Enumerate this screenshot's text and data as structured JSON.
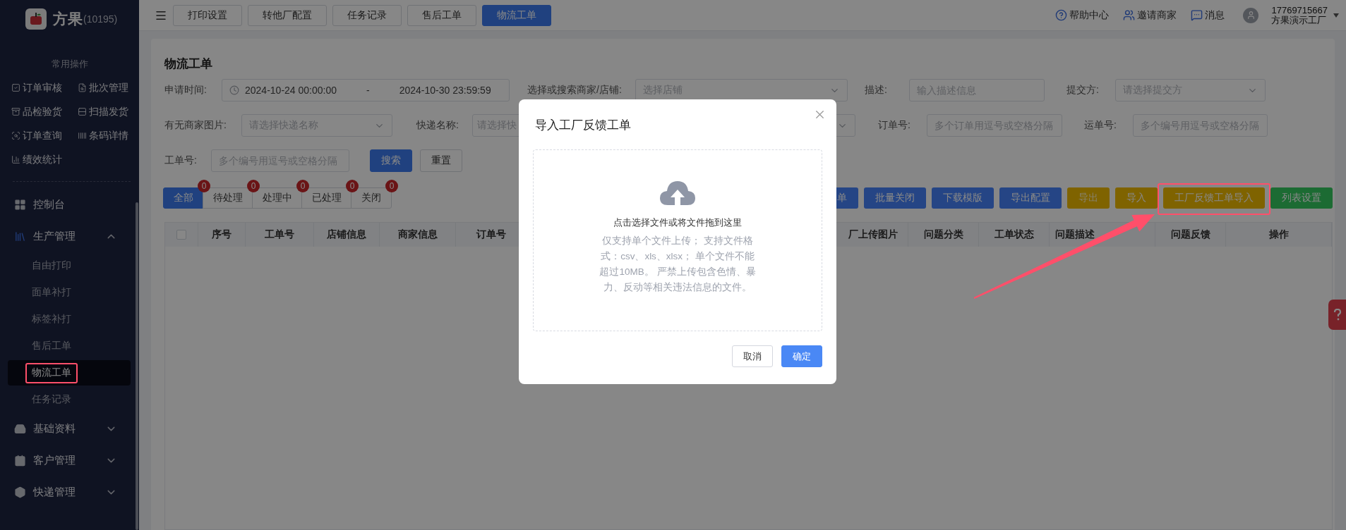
{
  "sidebar": {
    "logo": {
      "name": "方果",
      "code": "(10195)"
    },
    "quick_title": "常用操作",
    "quick_actions": [
      {
        "label": "订单审核"
      },
      {
        "label": "批次管理"
      },
      {
        "label": "品检验货"
      },
      {
        "label": "扫描发货"
      },
      {
        "label": "订单查询"
      },
      {
        "label": "条码详情"
      },
      {
        "label": "绩效统计"
      }
    ],
    "menu": [
      {
        "label": "控制台",
        "kind": "link"
      },
      {
        "label": "生产管理",
        "kind": "group",
        "expanded": true,
        "children": [
          {
            "label": "自由打印",
            "selected": false,
            "highlighted": false
          },
          {
            "label": "面单补打",
            "selected": false,
            "highlighted": false
          },
          {
            "label": "标签补打",
            "selected": false,
            "highlighted": false
          },
          {
            "label": "售后工单",
            "selected": false,
            "highlighted": false
          },
          {
            "label": "物流工单",
            "selected": true,
            "highlighted": true
          },
          {
            "label": "任务记录",
            "selected": false,
            "highlighted": false
          }
        ]
      },
      {
        "label": "基础资料",
        "kind": "group",
        "expanded": false
      },
      {
        "label": "客户管理",
        "kind": "group",
        "expanded": false
      },
      {
        "label": "快递管理",
        "kind": "group",
        "expanded": false
      }
    ]
  },
  "topbar": {
    "tabs": [
      {
        "label": "打印设置",
        "selected": false
      },
      {
        "label": "转他厂配置",
        "selected": false
      },
      {
        "label": "任务记录",
        "selected": false
      },
      {
        "label": "售后工单",
        "selected": false
      },
      {
        "label": "物流工单",
        "selected": true
      }
    ],
    "links": [
      {
        "label": "帮助中心"
      },
      {
        "label": "邀请商家"
      },
      {
        "label": "消息"
      }
    ],
    "user": {
      "phone": "17769715667",
      "name": "方果演示工厂"
    }
  },
  "page": {
    "title": "物流工单",
    "filters": [
      [
        {
          "kind": "date-range",
          "label": "申请时间:",
          "start": "2024-10-24 00:00:00",
          "separator": "-",
          "end": "2024-10-30 23:59:59"
        },
        {
          "kind": "select",
          "label": "选择或搜索商家/店铺:",
          "placeholder": "选择店铺"
        },
        {
          "kind": "input",
          "label": "描述:",
          "placeholder": "输入描述信息"
        },
        {
          "kind": "select",
          "label": "提交方:",
          "placeholder": "请选择提交方"
        }
      ],
      [
        {
          "kind": "select",
          "label": "有无商家图片:",
          "placeholder": "请选择快递名称"
        },
        {
          "kind": "select",
          "label": "快递名称:",
          "placeholder": "请选择快"
        },
        {
          "kind": "select"
        },
        {
          "kind": "input",
          "label": "订单号:",
          "placeholder": "多个订单用逗号或空格分隔"
        },
        {
          "kind": "input",
          "label": "运单号:",
          "placeholder": "多个编号用逗号或空格分隔"
        }
      ],
      [
        {
          "kind": "input",
          "label": "工单号:",
          "placeholder": "多个编号用逗号或空格分隔"
        }
      ]
    ],
    "search_button": "搜索",
    "reset_button": "重置",
    "status_tabs": [
      {
        "label": "全部",
        "count": "0",
        "selected": true
      },
      {
        "label": "待处理",
        "count": "0",
        "selected": false
      },
      {
        "label": "处理中",
        "count": "0",
        "selected": false
      },
      {
        "label": "已处理",
        "count": "0",
        "selected": false
      },
      {
        "label": "关闭",
        "count": "0",
        "selected": false
      }
    ],
    "actions": [
      {
        "label": "单",
        "color": "#254585",
        "disabled": false,
        "highlighted": false
      },
      {
        "label": "批量关闭",
        "color": "#254585",
        "disabled": false,
        "highlighted": false
      },
      {
        "label": "下载模版",
        "color": "#254585",
        "disabled": false,
        "highlighted": false
      },
      {
        "label": "导出配置",
        "color": "#254585",
        "disabled": false,
        "highlighted": false
      },
      {
        "label": "导出",
        "color": "#7f6300",
        "disabled": true,
        "highlighted": false
      },
      {
        "label": "导入",
        "color": "#7f6300",
        "disabled": false,
        "highlighted": false
      },
      {
        "label": "工厂反馈工单导入",
        "color": "#7f6300",
        "disabled": false,
        "highlighted": true
      },
      {
        "label": "列表设置",
        "color": "#1c6b33",
        "disabled": false,
        "highlighted": false
      }
    ],
    "table": {
      "columns": [
        {
          "kind": "checkbox",
          "checked": false
        },
        {
          "kind": "text",
          "label": "序号"
        },
        {
          "kind": "text",
          "label": "工单号"
        },
        {
          "kind": "text",
          "label": "店铺信息"
        },
        {
          "kind": "text",
          "label": "商家信息"
        },
        {
          "kind": "text",
          "label": "订单号"
        },
        {
          "kind": "text",
          "label": "厂上传图片"
        },
        {
          "kind": "text",
          "label": "问题分类"
        },
        {
          "kind": "text",
          "label": "工单状态"
        },
        {
          "kind": "text",
          "label": "问题描述"
        },
        {
          "kind": "text",
          "label": "问题反馈"
        },
        {
          "kind": "text",
          "label": "操作"
        }
      ]
    }
  },
  "modal": {
    "title": "导入工厂反馈工单",
    "prompt": "点击选择文件或将文件拖到这里",
    "hint": "仅支持单个文件上传； 支持文件格式：csv、xls、xlsx； 单个文件不能超过10MB。 严禁上传包含色情、暴力、反动等相关违法信息的文件。",
    "buttons": [
      {
        "label": "取消",
        "kind": "secondary"
      },
      {
        "label": "确定",
        "kind": "primary"
      }
    ]
  }
}
